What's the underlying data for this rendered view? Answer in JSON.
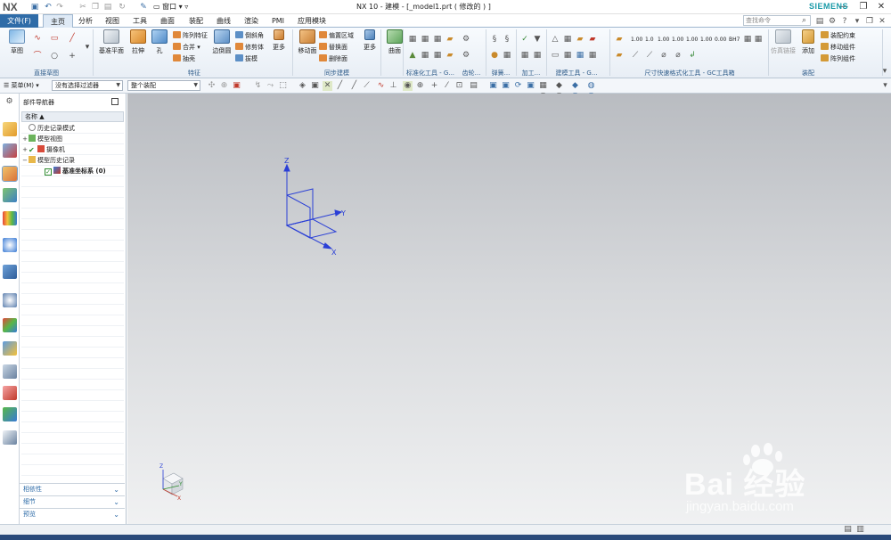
{
  "app": {
    "logo": "NX",
    "title": "NX 10 - 建模 - [_model1.prt  ( 修改的 ) ]",
    "window_menu": "窗口",
    "brand": "SIEMENS",
    "search_placeholder": "查找命令"
  },
  "menu": {
    "file": "文件(F)",
    "tabs": [
      "主页",
      "分析",
      "视图",
      "工具",
      "曲面",
      "装配",
      "曲线",
      "渲染",
      "PMI",
      "应用模块"
    ]
  },
  "ribbon": {
    "groups": {
      "sketch": "直接草图",
      "feature": "特征",
      "sync": "同步建模",
      "std": "标准化工具 - G...",
      "gear": "齿轮...",
      "spring": "弹簧...",
      "machining": "加工...",
      "model_tools": "建模工具 - G...",
      "dim": "尺寸快速格式化工具 - GC工具箱",
      "assembly": "装配"
    },
    "buttons": {
      "sketch": "草图",
      "datum_plane": "基准平面",
      "extrude": "拉伸",
      "hole": "孔",
      "pattern_feature": "阵列特征",
      "unite": "合并",
      "shell": "抽壳",
      "edge_blend": "边倒圆",
      "chamfer": "倒斜角",
      "trim_body": "修剪体",
      "draft": "拔模",
      "more1": "更多",
      "move_face": "移动面",
      "offset_region": "偏置区域",
      "replace_face": "替换面",
      "delete_face": "删除面",
      "more2": "更多",
      "surface": "曲面",
      "wave_linker": "仿真链接",
      "add": "添加",
      "assembly_constraint": "装配约束",
      "move_component": "移动组件",
      "pattern_component": "阵列组件"
    },
    "dim_labels": [
      "1.00",
      "1.0",
      "1.00",
      "1.00",
      "1.00",
      "1.00",
      "0.00",
      "BH7"
    ]
  },
  "toolbar2": {
    "menu": "菜单(M)",
    "filter": "没有选择过滤器",
    "scope": "整个装配"
  },
  "navigator": {
    "title": "部件导航器",
    "column": "名称",
    "rows": [
      {
        "label": "历史记录模式",
        "exp": ""
      },
      {
        "label": "模型视图",
        "exp": "+"
      },
      {
        "label": "摄像机",
        "exp": "+"
      },
      {
        "label": "模型历史记录",
        "exp": "−"
      },
      {
        "label": "基准坐标系 (0)",
        "exp": ""
      }
    ],
    "accordions": [
      "相依性",
      "细节",
      "预览"
    ]
  },
  "viewport": {
    "axis_labels": {
      "z": "Z",
      "y": "Y",
      "x": "X"
    },
    "mini_labels": {
      "z": "Z",
      "y": "Y",
      "x": "X"
    }
  },
  "watermark": {
    "main": "Bai 经验",
    "sub": "jingyan.baidu.com"
  },
  "colors": {
    "accent": "#2f6ca8",
    "siemens": "#199aa8",
    "axis": "#2a3fd6"
  }
}
